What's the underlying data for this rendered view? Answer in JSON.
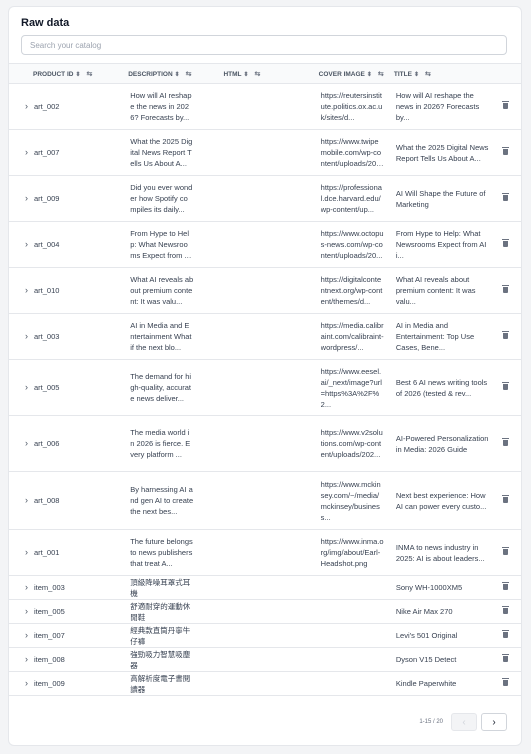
{
  "panel": {
    "title": "Raw data"
  },
  "search": {
    "placeholder": "Search your catalog"
  },
  "table": {
    "columns": {
      "product_id": "PRODUCT ID",
      "description": "DESCRIPTION",
      "html": "HTML",
      "cover_image": "COVER IMAGE",
      "title": "TITLE"
    },
    "rows": [
      {
        "id": "art_002",
        "description": "How will AI reshape the news in 2026? Forecasts by...",
        "html": "",
        "cover": "https://reutersinstitute.politics.ox.ac.uk/sites/d...",
        "title": "How will AI reshape the news in 2026? Forecasts by..."
      },
      {
        "id": "art_007",
        "description": "What the 2025 Digital News Report Tells Us About A...",
        "html": "",
        "cover": "https://www.twipemobile.com/wp-content/uploads/202...",
        "title": "What the 2025 Digital News Report Tells Us About A..."
      },
      {
        "id": "art_009",
        "description": "Did you ever wonder how Spotify compiles its daily...",
        "html": "",
        "cover": "https://professional.dce.harvard.edu/wp-content/up...",
        "title": "AI Will Shape the Future of Marketing"
      },
      {
        "id": "art_004",
        "description": "From Hype to Help: What Newsrooms Expect from AI i...",
        "html": "",
        "cover": "https://www.octopus-news.com/wp-content/uploads/20...",
        "title": "From Hype to Help: What Newsrooms Expect from AI i..."
      },
      {
        "id": "art_010",
        "description": "What AI reveals about premium content: It was valu...",
        "html": "",
        "cover": "https://digitalcontentnext.org/wp-content/themes/d...",
        "title": "What AI reveals about premium content: It was valu..."
      },
      {
        "id": "art_003",
        "description": "AI in Media and Entertainment What if the next blo...",
        "html": "",
        "cover": "https://media.calibraint.com/calibraint-wordpress/...",
        "title": "AI in Media and Entertainment: Top Use Cases, Bene..."
      },
      {
        "id": "art_005",
        "description": "The demand for high-quality, accurate news deliver...",
        "html": "",
        "cover": "https://www.eesel.ai/_next/image?url=https%3A%2F%2...",
        "title": "Best 6 AI news writing tools of 2026 (tested & rev..."
      },
      {
        "id": "art_006",
        "description": "The media world in 2026 is fierce. Every platform ...",
        "html": "",
        "cover": "https://www.v2solutions.com/wp-content/uploads/202...",
        "title": "AI-Powered Personalization in Media: 2026 Guide"
      },
      {
        "id": "art_008",
        "description": "By harnessing AI and gen AI to create the next bes...",
        "html": "",
        "cover": "https://www.mckinsey.com/~/media/mckinsey/business...",
        "title": "Next best experience: How AI can power every custo..."
      },
      {
        "id": "art_001",
        "description": "The future belongs to news publishers that treat A...",
        "html": "",
        "cover": "https://www.inma.org/img/about/Earl-Headshot.png",
        "title": "INMA to news industry in 2025: AI is about leaders..."
      },
      {
        "id": "item_003",
        "description": "頂級降噪耳罩式耳機",
        "html": "",
        "cover": "",
        "title": "Sony WH-1000XM5"
      },
      {
        "id": "item_005",
        "description": "舒適耐穿的運動休閒鞋",
        "html": "",
        "cover": "",
        "title": "Nike Air Max 270"
      },
      {
        "id": "item_007",
        "description": "經典款直筒丹寧牛仔褲",
        "html": "",
        "cover": "",
        "title": "Levi's 501 Original"
      },
      {
        "id": "item_008",
        "description": "強勁吸力智慧吸塵器",
        "html": "",
        "cover": "",
        "title": "Dyson V15 Detect"
      },
      {
        "id": "item_009",
        "description": "高解析度電子書閱讀器",
        "html": "",
        "cover": "",
        "title": "Kindle Paperwhite"
      }
    ]
  },
  "pagination": {
    "range": "1-15 / 20",
    "prev": "‹",
    "next": "›"
  },
  "icons": {
    "sort": "sort-icon",
    "resize": "resize-icon",
    "expand": "chevron-right-icon",
    "delete": "trash-icon"
  }
}
